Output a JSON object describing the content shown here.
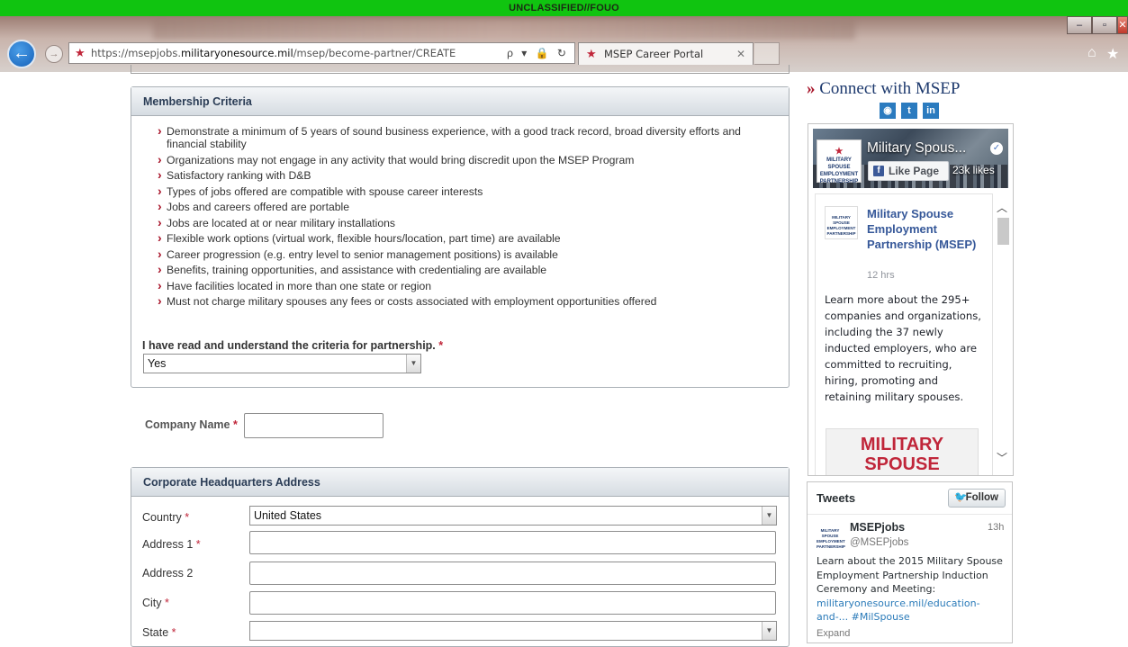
{
  "banner": {
    "text": "UNCLASSIFIED//FOUO"
  },
  "browser": {
    "url_prefix": "https://msepjobs.",
    "url_domain": "militaryonesource.mil",
    "url_path": "/msep/become-partner/CREATE",
    "tab_title": "MSEP Career Portal",
    "address_tools": "ρ ▾ 🔒 ↻"
  },
  "membership": {
    "heading": "Membership Criteria",
    "criteria": [
      "Demonstrate a minimum of 5 years of sound business experience, with a good track record, broad diversity efforts and financial stability",
      "Organizations may not engage in any activity that would bring discredit upon the MSEP Program",
      "Satisfactory ranking with D&B",
      "Types of jobs offered are compatible with spouse career interests",
      "Jobs and careers offered are portable",
      "Jobs are located at or near military installations",
      "Flexible work options (virtual work, flexible hours/location, part time) are available",
      "Career progression (e.g. entry level to senior management positions) is available",
      "Benefits, training opportunities, and assistance with credentialing are available",
      "Have facilities located in more than one state or region",
      "Must not charge military spouses any fees or costs associated with employment opportunities offered"
    ],
    "agree_label": "I have read and understand the criteria for partnership.",
    "agree_value": "Yes",
    "required_mark": "*"
  },
  "company": {
    "label": "Company Name",
    "value": ""
  },
  "hq": {
    "heading": "Corporate Headquarters Address",
    "country_label": "Country",
    "country_value": "United States",
    "address1_label": "Address 1",
    "address2_label": "Address 2",
    "city_label": "City",
    "state_label": "State",
    "state_value": ""
  },
  "sidebar": {
    "connect_title": "Connect with MSEP",
    "raquo": "»",
    "social": [
      "rss-icon",
      "twitter-icon",
      "linkedin-icon"
    ],
    "facebook": {
      "page_name": "Military Spous...",
      "like_label": "Like Page",
      "likes": "23k likes",
      "logo_text": "MILITARY SPOUSE EMPLOYMENT PARTNERSHIP",
      "post_author": "Military Spouse Employment Partnership (MSEP)",
      "post_time": "12 hrs",
      "post_text": "Learn more about the 295+ companies and organizations, including the 37 newly inducted employers, who are committed to recruiting, hiring, promoting and retaining military spouses.",
      "post_image_line1": "MILITARY",
      "post_image_line2": "SPOUSE"
    },
    "twitter": {
      "heading": "Tweets",
      "follow_label": "Follow",
      "name": "MSEPjobs",
      "handle": "@MSEPjobs",
      "time": "13h",
      "text": "Learn about the 2015 Military Spouse Employment Partnership Induction Ceremony and Meeting: ",
      "link": "militaryonesource.mil/education-and-... #MilSpouse",
      "expand": "Expand"
    }
  },
  "colors": {
    "banner": "#10c410",
    "accent_red": "#a8152a",
    "heading_blue": "#2a3c55",
    "link_blue": "#365899"
  }
}
